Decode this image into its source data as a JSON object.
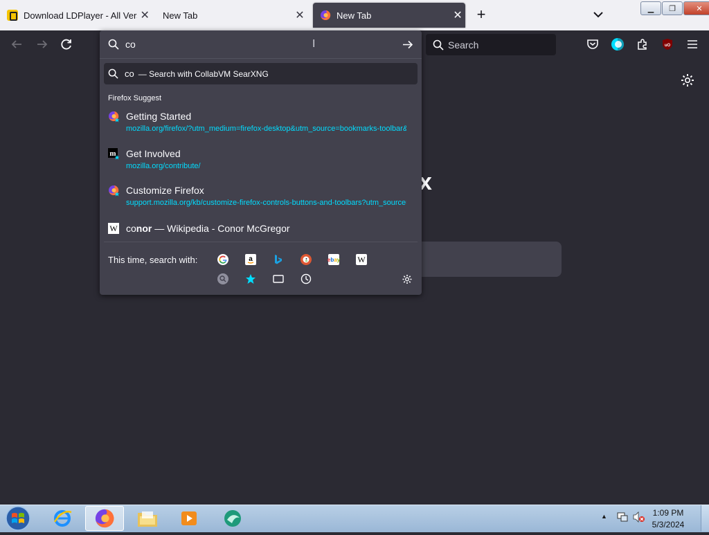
{
  "tabs": [
    {
      "title": "Download LDPlayer - All Versions",
      "active": false,
      "favicon": "ldplayer-icon"
    },
    {
      "title": "New Tab",
      "active": false,
      "favicon": ""
    },
    {
      "title": "New Tab",
      "active": true,
      "favicon": "firefox-icon"
    }
  ],
  "toolbar": {
    "search_placeholder": "Search"
  },
  "urlbar": {
    "value": "co",
    "search_row": {
      "query": "co",
      "label": "— Search with CollabVM SearXNG"
    },
    "section_heading": "Firefox Suggest",
    "suggestions": [
      {
        "title": "Getting Started",
        "url": "mozilla.org/firefox/?utm_medium=firefox-desktop&utm_source=bookmarks-toolbar&utm_campaign=new-users&utm_content=-global",
        "icon": "firefox-icon"
      },
      {
        "title": "Get Involved",
        "url": "mozilla.org/contribute/",
        "icon": "mozilla-m-icon"
      },
      {
        "title": "Customize Firefox",
        "url": "support.mozilla.org/kb/customize-firefox-controls-buttons-and-toolbars?utm_source=firefox-browser&utm_medium=default-bookmarks",
        "icon": "firefox-icon"
      }
    ],
    "wiki": {
      "prefix": "co",
      "bold": "nor",
      "rest": " — Wikipedia - Conor McGregor"
    },
    "search_with_label": "This time, search with:",
    "engines": [
      "Google",
      "Amazon",
      "Bing",
      "DuckDuckGo",
      "eBay",
      "Wikipedia"
    ]
  },
  "taskbar": {
    "time": "1:09 PM",
    "date": "5/3/2024"
  }
}
